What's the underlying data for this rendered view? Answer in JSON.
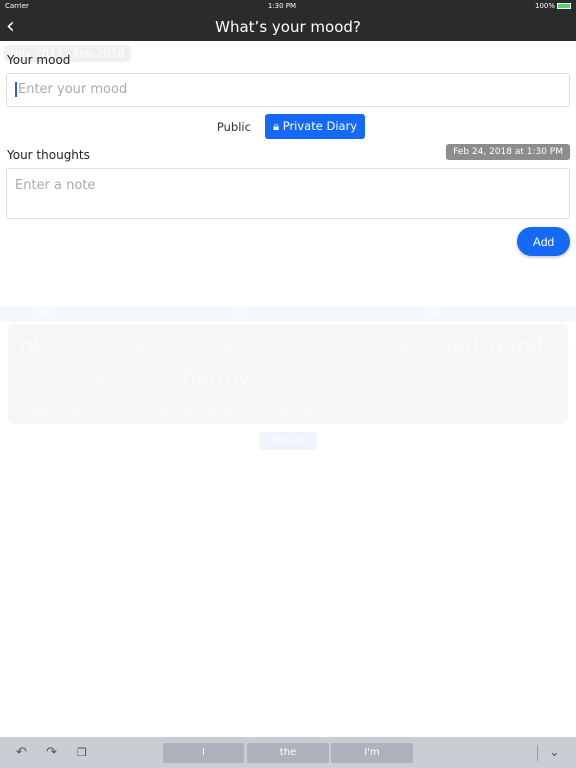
{
  "status": {
    "carrier": "Carrier",
    "time": "1:30 PM",
    "battery": "100%"
  },
  "nav": {
    "title": "What’s your mood?",
    "back_icon": "chevron-left"
  },
  "background": {
    "range": "Nov 2017 - Feb 2018",
    "months": [
      "Dec",
      "Jan",
      "Feb"
    ],
    "words": [
      "ok",
      "bloated",
      "mediocre",
      "miserable",
      "aggravated",
      "angry",
      "wonderful",
      "sad",
      "good",
      "much better",
      "excellent",
      "unsure",
      "happy",
      "insomnia",
      "really upset",
      "nervous",
      "anticipating",
      "better",
      "uninspired",
      "sick"
    ],
    "moods_button": "20 Moods"
  },
  "form": {
    "mood_label": "Your mood",
    "mood_placeholder": "Enter your mood",
    "mood_value": "",
    "public_label": "Public",
    "private_label": "Private Diary",
    "private_selected": true,
    "thoughts_label": "Your thoughts",
    "date": "Feb 24, 2018 at 1:30 PM",
    "note_placeholder": "Enter a note",
    "add_label": "Add",
    "accent": "#1469f5"
  },
  "keyboard": {
    "suggestions": [
      "I",
      "the",
      "I'm"
    ]
  }
}
